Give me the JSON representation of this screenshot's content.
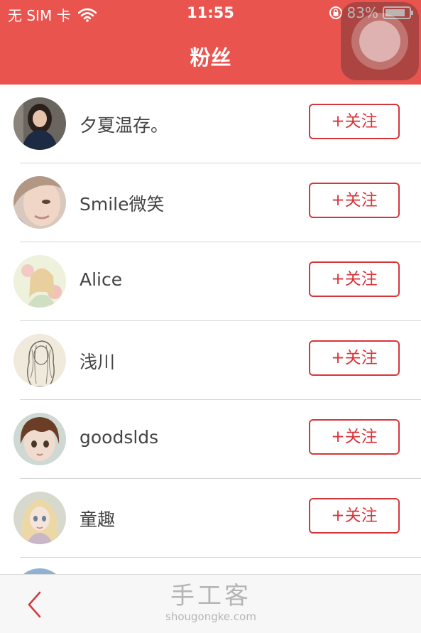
{
  "status_bar": {
    "carrier": "无 SIM 卡",
    "time": "11:55",
    "battery": "83%",
    "icons": [
      "wifi-icon",
      "rotation-lock-icon",
      "battery-icon"
    ]
  },
  "nav": {
    "title": "粉丝"
  },
  "followers": [
    {
      "name": "夕夏温存。",
      "button": "+关注",
      "avatar": "photo-girl-dark-hair"
    },
    {
      "name": "Smile微笑",
      "button": "+关注",
      "avatar": "photo-closeup-face"
    },
    {
      "name": "Alice",
      "button": "+关注",
      "avatar": "illustration-pastel-girl"
    },
    {
      "name": "浅川",
      "button": "+关注",
      "avatar": "sketch-girl"
    },
    {
      "name": "goodslds",
      "button": "+关注",
      "avatar": "doll-brown-hair"
    },
    {
      "name": "童趣",
      "button": "+关注",
      "avatar": "doll-blonde"
    }
  ],
  "tabbar": {
    "back_icon": "chevron-left-icon",
    "watermark_title": "手工客",
    "watermark_domain": "shougongke.com"
  },
  "colors": {
    "header": "#e9544f",
    "accent": "#d8353a",
    "text": "#444444",
    "divider": "#d6d6d6",
    "tabbar": "#f7f7f7"
  }
}
